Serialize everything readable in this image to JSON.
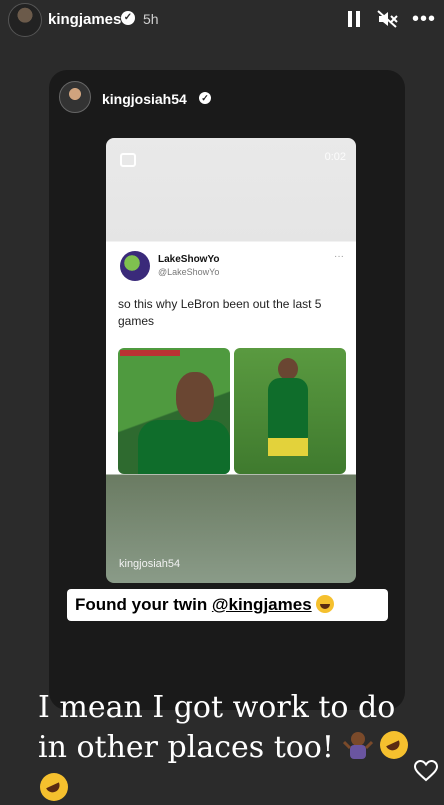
{
  "header": {
    "username": "kingjames",
    "verified_icon": "verified-badge-icon",
    "time": "5h",
    "icons": [
      "pause-icon",
      "mute-icon",
      "more-options-icon"
    ]
  },
  "shared_post": {
    "username": "kingjosiah54",
    "verified_icon": "verified-badge-icon",
    "reel_time": "0:02",
    "tweet": {
      "name": "LakeShowYo",
      "handle": "@LakeShowYo",
      "text": "so this why LeBron been out the last 5 games"
    },
    "reel_footer": "kingjosiah54"
  },
  "caption_sticker": {
    "prefix": "Found your twin ",
    "mention": "@kingjames",
    "emoji": "face-with-tears-of-joy-icon"
  },
  "story_text": "I mean I got work to do in other places too!",
  "decorations": [
    "shrug-emoji-icon",
    "rofl-emoji-icon",
    "heart-icon"
  ],
  "colors": {
    "background": "#2b2b2b",
    "card": "#1a1a1a",
    "sticker": "#ffffff"
  }
}
